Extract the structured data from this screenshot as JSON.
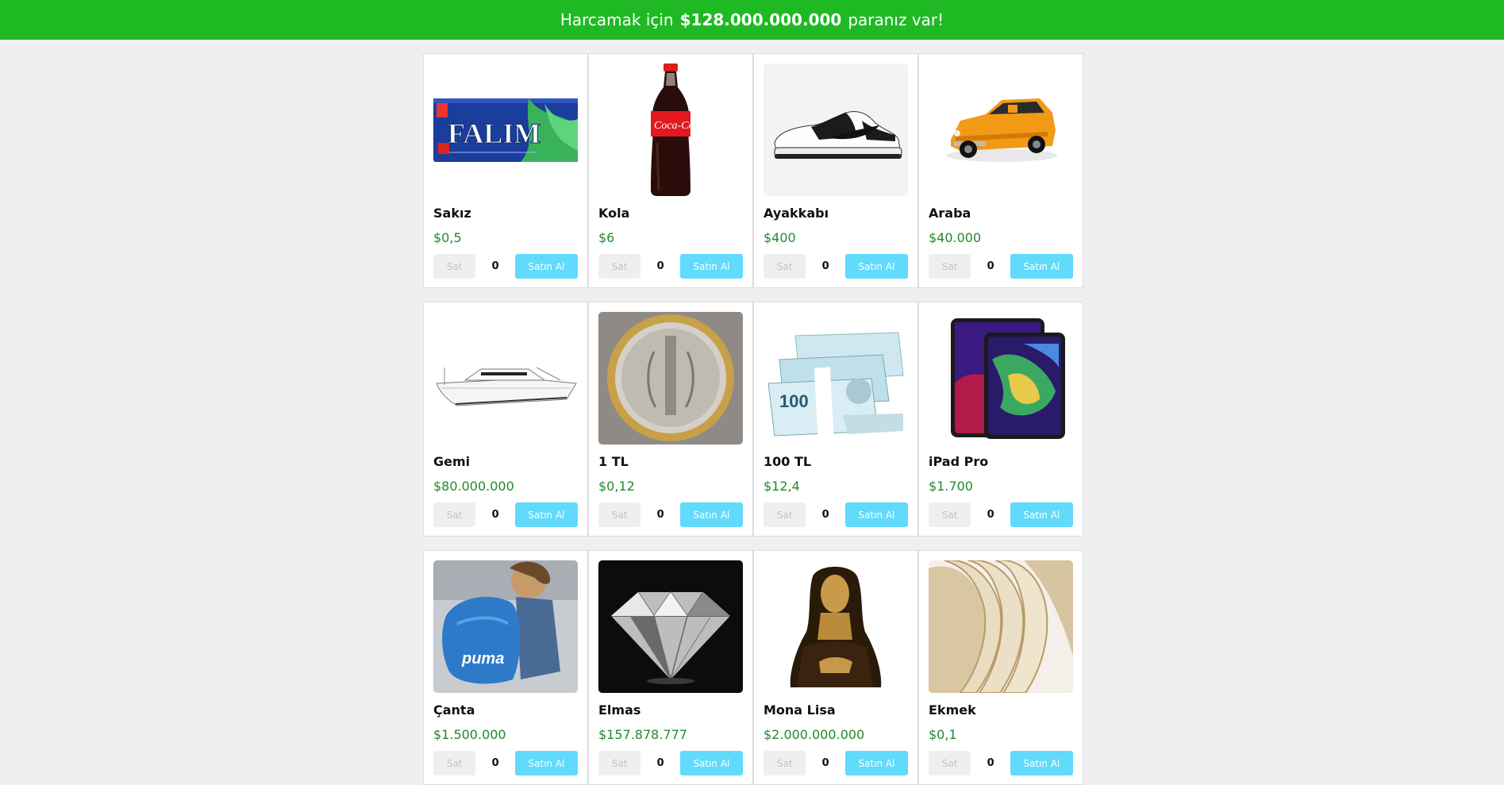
{
  "header": {
    "prefix": "Harcamak için",
    "amount": "$128.000.000.000",
    "suffix": "paranız var!"
  },
  "products": [
    {
      "name": "Sakız",
      "price": "$0,5",
      "sell": "Sat",
      "qty": "0",
      "buy": "Satın Al",
      "image": "gum-pack-falim"
    },
    {
      "name": "Kola",
      "price": "$6",
      "sell": "Sat",
      "qty": "0",
      "buy": "Satın Al",
      "image": "cola-bottle"
    },
    {
      "name": "Ayakkabı",
      "price": "$400",
      "sell": "Sat",
      "qty": "0",
      "buy": "Satın Al",
      "image": "sneaker"
    },
    {
      "name": "Araba",
      "price": "$40.000",
      "sell": "Sat",
      "qty": "0",
      "buy": "Satın Al",
      "image": "orange-car"
    },
    {
      "name": "Gemi",
      "price": "$80.000.000",
      "sell": "Sat",
      "qty": "0",
      "buy": "Satın Al",
      "image": "yacht"
    },
    {
      "name": "1 TL",
      "price": "$0,12",
      "sell": "Sat",
      "qty": "0",
      "buy": "Satın Al",
      "image": "coin"
    },
    {
      "name": "100 TL",
      "price": "$12,4",
      "sell": "Sat",
      "qty": "0",
      "buy": "Satın Al",
      "image": "banknotes"
    },
    {
      "name": "iPad Pro",
      "price": "$1.700",
      "sell": "Sat",
      "qty": "0",
      "buy": "Satın Al",
      "image": "tablet"
    },
    {
      "name": "Çanta",
      "price": "$1.500.000",
      "sell": "Sat",
      "qty": "0",
      "buy": "Satın Al",
      "image": "backpack"
    },
    {
      "name": "Elmas",
      "price": "$157.878.777",
      "sell": "Sat",
      "qty": "0",
      "buy": "Satın Al",
      "image": "diamond"
    },
    {
      "name": "Mona Lisa",
      "price": "$2.000.000.000",
      "sell": "Sat",
      "qty": "0",
      "buy": "Satın Al",
      "image": "painting"
    },
    {
      "name": "Ekmek",
      "price": "$0,1",
      "sell": "Sat",
      "qty": "0",
      "buy": "Satın Al",
      "image": "bread"
    }
  ],
  "images": {
    "gum_text": "FALIM"
  }
}
